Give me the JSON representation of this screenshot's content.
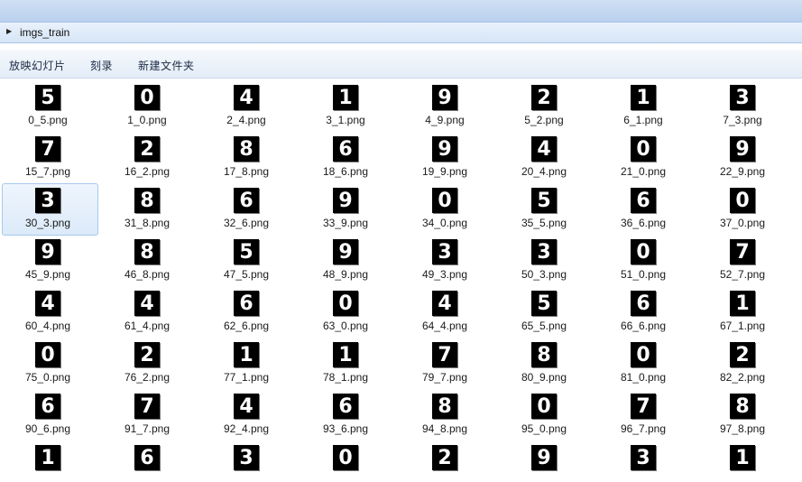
{
  "address": {
    "folder": "imgs_train"
  },
  "toolbar": {
    "slideshow": "放映幻灯片",
    "burn": "刻录",
    "new_folder": "新建文件夹"
  },
  "files": [
    {
      "name": "0_5.png",
      "digit": "5"
    },
    {
      "name": "1_0.png",
      "digit": "0"
    },
    {
      "name": "2_4.png",
      "digit": "4"
    },
    {
      "name": "3_1.png",
      "digit": "1"
    },
    {
      "name": "4_9.png",
      "digit": "9"
    },
    {
      "name": "5_2.png",
      "digit": "2"
    },
    {
      "name": "6_1.png",
      "digit": "1"
    },
    {
      "name": "7_3.png",
      "digit": "3"
    },
    {
      "name": "15_7.png",
      "digit": "7"
    },
    {
      "name": "16_2.png",
      "digit": "2"
    },
    {
      "name": "17_8.png",
      "digit": "8"
    },
    {
      "name": "18_6.png",
      "digit": "6"
    },
    {
      "name": "19_9.png",
      "digit": "9"
    },
    {
      "name": "20_4.png",
      "digit": "4"
    },
    {
      "name": "21_0.png",
      "digit": "0"
    },
    {
      "name": "22_9.png",
      "digit": "9"
    },
    {
      "name": "30_3.png",
      "digit": "3",
      "selected": true
    },
    {
      "name": "31_8.png",
      "digit": "8"
    },
    {
      "name": "32_6.png",
      "digit": "6"
    },
    {
      "name": "33_9.png",
      "digit": "9"
    },
    {
      "name": "34_0.png",
      "digit": "0"
    },
    {
      "name": "35_5.png",
      "digit": "5"
    },
    {
      "name": "36_6.png",
      "digit": "6"
    },
    {
      "name": "37_0.png",
      "digit": "0"
    },
    {
      "name": "45_9.png",
      "digit": "9"
    },
    {
      "name": "46_8.png",
      "digit": "8"
    },
    {
      "name": "47_5.png",
      "digit": "5"
    },
    {
      "name": "48_9.png",
      "digit": "9"
    },
    {
      "name": "49_3.png",
      "digit": "3"
    },
    {
      "name": "50_3.png",
      "digit": "3"
    },
    {
      "name": "51_0.png",
      "digit": "0"
    },
    {
      "name": "52_7.png",
      "digit": "7"
    },
    {
      "name": "60_4.png",
      "digit": "4"
    },
    {
      "name": "61_4.png",
      "digit": "4"
    },
    {
      "name": "62_6.png",
      "digit": "6"
    },
    {
      "name": "63_0.png",
      "digit": "0"
    },
    {
      "name": "64_4.png",
      "digit": "4"
    },
    {
      "name": "65_5.png",
      "digit": "5"
    },
    {
      "name": "66_6.png",
      "digit": "6"
    },
    {
      "name": "67_1.png",
      "digit": "1"
    },
    {
      "name": "75_0.png",
      "digit": "0"
    },
    {
      "name": "76_2.png",
      "digit": "2"
    },
    {
      "name": "77_1.png",
      "digit": "1"
    },
    {
      "name": "78_1.png",
      "digit": "1"
    },
    {
      "name": "79_7.png",
      "digit": "7"
    },
    {
      "name": "80_9.png",
      "digit": "8"
    },
    {
      "name": "81_0.png",
      "digit": "0"
    },
    {
      "name": "82_2.png",
      "digit": "2"
    },
    {
      "name": "90_6.png",
      "digit": "6"
    },
    {
      "name": "91_7.png",
      "digit": "7"
    },
    {
      "name": "92_4.png",
      "digit": "4"
    },
    {
      "name": "93_6.png",
      "digit": "6"
    },
    {
      "name": "94_8.png",
      "digit": "8"
    },
    {
      "name": "95_0.png",
      "digit": "0"
    },
    {
      "name": "96_7.png",
      "digit": "7"
    },
    {
      "name": "97_8.png",
      "digit": "8"
    },
    {
      "name": "",
      "digit": "1"
    },
    {
      "name": "",
      "digit": "6"
    },
    {
      "name": "",
      "digit": "3"
    },
    {
      "name": "",
      "digit": "0"
    },
    {
      "name": "",
      "digit": "2"
    },
    {
      "name": "",
      "digit": "9"
    },
    {
      "name": "",
      "digit": "3"
    },
    {
      "name": "",
      "digit": "1"
    }
  ]
}
